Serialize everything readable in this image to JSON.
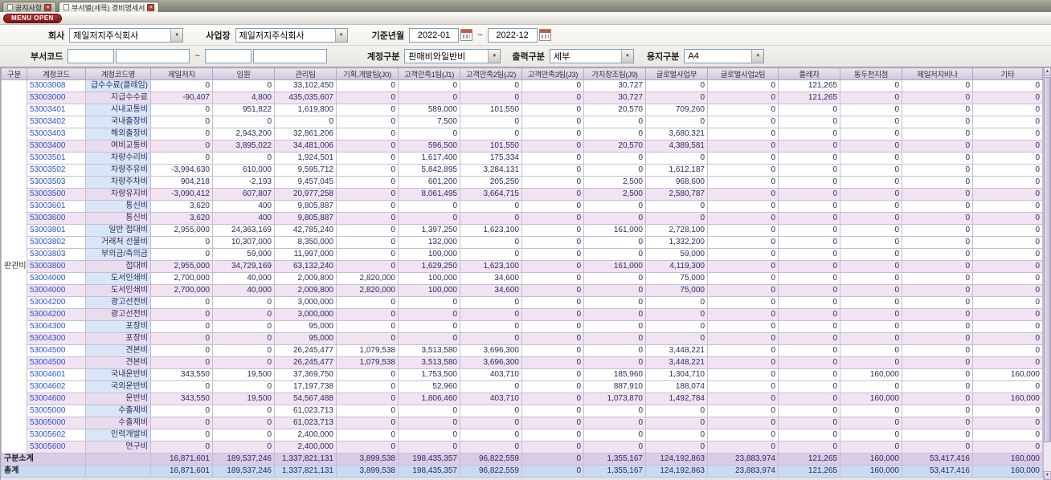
{
  "tabs": {
    "items": [
      {
        "label": "공지사항"
      },
      {
        "label": "부서별(세목) 경비명세서"
      }
    ]
  },
  "menu": {
    "open_label": "MENU OPEN"
  },
  "filters": {
    "company": {
      "label": "회사",
      "value": "제일저지주식회사"
    },
    "site": {
      "label": "사업장",
      "value": "제일저지주식회사"
    },
    "period": {
      "label": "기준년월",
      "from": "2022-01",
      "to": "2022-12",
      "separator": "~"
    },
    "dept_code": {
      "label": "부서코드",
      "from_code": "",
      "from_name": "",
      "to_code": "",
      "to_name": "",
      "separator": "~"
    },
    "account_type": {
      "label": "계정구분",
      "value": "판매비와일반비"
    },
    "output_type": {
      "label": "출력구분",
      "value": "세부"
    },
    "paper_type": {
      "label": "용지구분",
      "value": "A4"
    }
  },
  "grid": {
    "headers": [
      "구분",
      "계정코드",
      "계정코드명",
      "제일저지",
      "임원",
      "관리팀",
      "기획,개발팀(J0)",
      "고객만족1팀(J1)",
      "고객만족2팀(J2)",
      "고객만족3팀(J3)",
      "가치창조팀(J9)",
      "글로벌사업부",
      "글로벌사업2팀",
      "플레차",
      "동두천지점",
      "제일저지비나",
      "기타"
    ],
    "group_label": "판관비",
    "rows": [
      {
        "code": "53003008",
        "name": "급수수료(클레임)",
        "summary": false,
        "values": [
          "0",
          "0",
          "33,102,450",
          "0",
          "0",
          "0",
          "0",
          "30,727",
          "0",
          "0",
          "121,265",
          "0",
          "0",
          "0"
        ]
      },
      {
        "code": "53003000",
        "name": "지급수수료",
        "summary": true,
        "values": [
          "-90,407",
          "4,800",
          "435,035,607",
          "0",
          "0",
          "0",
          "0",
          "30,727",
          "0",
          "0",
          "121,265",
          "0",
          "0",
          "0"
        ]
      },
      {
        "code": "53003401",
        "name": "시내교통비",
        "summary": false,
        "values": [
          "0",
          "951,822",
          "1,619,800",
          "0",
          "589,000",
          "101,550",
          "0",
          "20,570",
          "709,260",
          "0",
          "0",
          "0",
          "0",
          "0"
        ]
      },
      {
        "code": "53003402",
        "name": "국내출장비",
        "summary": false,
        "values": [
          "0",
          "0",
          "0",
          "0",
          "7,500",
          "0",
          "0",
          "0",
          "0",
          "0",
          "0",
          "0",
          "0",
          "0"
        ]
      },
      {
        "code": "53003403",
        "name": "해외출장비",
        "summary": false,
        "values": [
          "0",
          "2,943,200",
          "32,861,206",
          "0",
          "0",
          "0",
          "0",
          "0",
          "3,680,321",
          "0",
          "0",
          "0",
          "0",
          "0"
        ]
      },
      {
        "code": "53003400",
        "name": "여비교통비",
        "summary": true,
        "values": [
          "0",
          "3,895,022",
          "34,481,006",
          "0",
          "596,500",
          "101,550",
          "0",
          "20,570",
          "4,389,581",
          "0",
          "0",
          "0",
          "0",
          "0"
        ]
      },
      {
        "code": "53003501",
        "name": "차량수리비",
        "summary": false,
        "values": [
          "0",
          "0",
          "1,924,501",
          "0",
          "1,617,400",
          "175,334",
          "0",
          "0",
          "0",
          "0",
          "0",
          "0",
          "0",
          "0"
        ]
      },
      {
        "code": "53003502",
        "name": "차량주유비",
        "summary": false,
        "values": [
          "-3,994,630",
          "610,000",
          "9,595,712",
          "0",
          "5,842,895",
          "3,284,131",
          "0",
          "0",
          "1,612,187",
          "0",
          "0",
          "0",
          "0",
          "0"
        ]
      },
      {
        "code": "53003503",
        "name": "차량주차비",
        "summary": false,
        "values": [
          "904,218",
          "-2,193",
          "9,457,045",
          "0",
          "601,200",
          "205,250",
          "0",
          "2,500",
          "968,600",
          "0",
          "0",
          "0",
          "0",
          "0"
        ]
      },
      {
        "code": "53003500",
        "name": "차량유지비",
        "summary": true,
        "values": [
          "-3,090,412",
          "607,807",
          "20,977,258",
          "0",
          "8,061,495",
          "3,664,715",
          "0",
          "2,500",
          "2,580,787",
          "0",
          "0",
          "0",
          "0",
          "0"
        ]
      },
      {
        "code": "53003601",
        "name": "통신비",
        "summary": false,
        "values": [
          "3,620",
          "400",
          "9,805,887",
          "0",
          "0",
          "0",
          "0",
          "0",
          "0",
          "0",
          "0",
          "0",
          "0",
          "0"
        ]
      },
      {
        "code": "53003600",
        "name": "통신비",
        "summary": true,
        "values": [
          "3,620",
          "400",
          "9,805,887",
          "0",
          "0",
          "0",
          "0",
          "0",
          "0",
          "0",
          "0",
          "0",
          "0",
          "0"
        ]
      },
      {
        "code": "53003801",
        "name": "일반 접대비",
        "summary": false,
        "values": [
          "2,955,000",
          "24,363,169",
          "42,785,240",
          "0",
          "1,397,250",
          "1,623,100",
          "0",
          "161,000",
          "2,728,100",
          "0",
          "0",
          "0",
          "0",
          "0"
        ]
      },
      {
        "code": "53003802",
        "name": "거래처 선물비",
        "summary": false,
        "values": [
          "0",
          "10,307,000",
          "8,350,000",
          "0",
          "132,000",
          "0",
          "0",
          "0",
          "1,332,200",
          "0",
          "0",
          "0",
          "0",
          "0"
        ]
      },
      {
        "code": "53003803",
        "name": "부의금/축의금",
        "summary": false,
        "values": [
          "0",
          "59,000",
          "11,997,000",
          "0",
          "100,000",
          "0",
          "0",
          "0",
          "59,000",
          "0",
          "0",
          "0",
          "0",
          "0"
        ]
      },
      {
        "code": "53003800",
        "name": "접대비",
        "summary": true,
        "values": [
          "2,955,000",
          "34,729,169",
          "63,132,240",
          "0",
          "1,629,250",
          "1,623,100",
          "0",
          "161,000",
          "4,119,300",
          "0",
          "0",
          "0",
          "0",
          "0"
        ]
      },
      {
        "code": "53004000",
        "name": "도서인쇄비",
        "summary": false,
        "values": [
          "2,700,000",
          "40,000",
          "2,009,800",
          "2,820,000",
          "100,000",
          "34,600",
          "0",
          "0",
          "75,000",
          "0",
          "0",
          "0",
          "0",
          "0"
        ]
      },
      {
        "code": "53004000",
        "name": "도서인쇄비",
        "summary": true,
        "values": [
          "2,700,000",
          "40,000",
          "2,009,800",
          "2,820,000",
          "100,000",
          "34,600",
          "0",
          "0",
          "75,000",
          "0",
          "0",
          "0",
          "0",
          "0"
        ]
      },
      {
        "code": "53004200",
        "name": "광고선전비",
        "summary": false,
        "values": [
          "0",
          "0",
          "3,000,000",
          "0",
          "0",
          "0",
          "0",
          "0",
          "0",
          "0",
          "0",
          "0",
          "0",
          "0"
        ]
      },
      {
        "code": "53004200",
        "name": "광고선전비",
        "summary": true,
        "values": [
          "0",
          "0",
          "3,000,000",
          "0",
          "0",
          "0",
          "0",
          "0",
          "0",
          "0",
          "0",
          "0",
          "0",
          "0"
        ]
      },
      {
        "code": "53004300",
        "name": "포장비",
        "summary": false,
        "values": [
          "0",
          "0",
          "95,000",
          "0",
          "0",
          "0",
          "0",
          "0",
          "0",
          "0",
          "0",
          "0",
          "0",
          "0"
        ]
      },
      {
        "code": "53004300",
        "name": "포장비",
        "summary": true,
        "values": [
          "0",
          "0",
          "95,000",
          "0",
          "0",
          "0",
          "0",
          "0",
          "0",
          "0",
          "0",
          "0",
          "0",
          "0"
        ]
      },
      {
        "code": "53004500",
        "name": "견본비",
        "summary": false,
        "values": [
          "0",
          "0",
          "26,245,477",
          "1,079,538",
          "3,513,580",
          "3,696,300",
          "0",
          "0",
          "3,448,221",
          "0",
          "0",
          "0",
          "0",
          "0"
        ]
      },
      {
        "code": "53004500",
        "name": "견본비",
        "summary": true,
        "values": [
          "0",
          "0",
          "26,245,477",
          "1,079,538",
          "3,513,580",
          "3,696,300",
          "0",
          "0",
          "3,448,221",
          "0",
          "0",
          "0",
          "0",
          "0"
        ]
      },
      {
        "code": "53004601",
        "name": "국내운반비",
        "summary": false,
        "values": [
          "343,550",
          "19,500",
          "37,369,750",
          "0",
          "1,753,500",
          "403,710",
          "0",
          "185,960",
          "1,304,710",
          "0",
          "0",
          "160,000",
          "0",
          "160,000"
        ]
      },
      {
        "code": "53004602",
        "name": "국외운반비",
        "summary": false,
        "values": [
          "0",
          "0",
          "17,197,738",
          "0",
          "52,960",
          "0",
          "0",
          "887,910",
          "188,074",
          "0",
          "0",
          "0",
          "0",
          "0"
        ]
      },
      {
        "code": "53004600",
        "name": "운반비",
        "summary": true,
        "values": [
          "343,550",
          "19,500",
          "54,567,488",
          "0",
          "1,806,460",
          "403,710",
          "0",
          "1,073,870",
          "1,492,784",
          "0",
          "0",
          "160,000",
          "0",
          "160,000"
        ]
      },
      {
        "code": "53005000",
        "name": "수출제비",
        "summary": false,
        "values": [
          "0",
          "0",
          "61,023,713",
          "0",
          "0",
          "0",
          "0",
          "0",
          "0",
          "0",
          "0",
          "0",
          "0",
          "0"
        ]
      },
      {
        "code": "53005000",
        "name": "수출제비",
        "summary": true,
        "values": [
          "0",
          "0",
          "61,023,713",
          "0",
          "0",
          "0",
          "0",
          "0",
          "0",
          "0",
          "0",
          "0",
          "0",
          "0"
        ]
      },
      {
        "code": "53005602",
        "name": "인력개발비",
        "summary": false,
        "values": [
          "0",
          "0",
          "2,400,000",
          "0",
          "0",
          "0",
          "0",
          "0",
          "0",
          "0",
          "0",
          "0",
          "0",
          "0"
        ]
      },
      {
        "code": "53005600",
        "name": "연구비",
        "summary": true,
        "values": [
          "0",
          "0",
          "2,400,000",
          "0",
          "0",
          "0",
          "0",
          "0",
          "0",
          "0",
          "0",
          "0",
          "0",
          "0"
        ]
      }
    ],
    "footer": [
      {
        "label": "구분소계",
        "values": [
          "16,871,601",
          "189,537,246",
          "1,337,821,131",
          "3,899,538",
          "198,435,357",
          "96,822,559",
          "0",
          "1,355,167",
          "124,192,863",
          "23,883,974",
          "121,265",
          "160,000",
          "53,417,416",
          "160,000"
        ]
      },
      {
        "label": "총계",
        "values": [
          "16,871,601",
          "189,537,246",
          "1,337,821,131",
          "3,899,538",
          "198,435,357",
          "96,822,559",
          "0",
          "1,355,167",
          "124,192,863",
          "23,883,974",
          "121,265",
          "160,000",
          "53,417,416",
          "160,000"
        ]
      }
    ]
  }
}
